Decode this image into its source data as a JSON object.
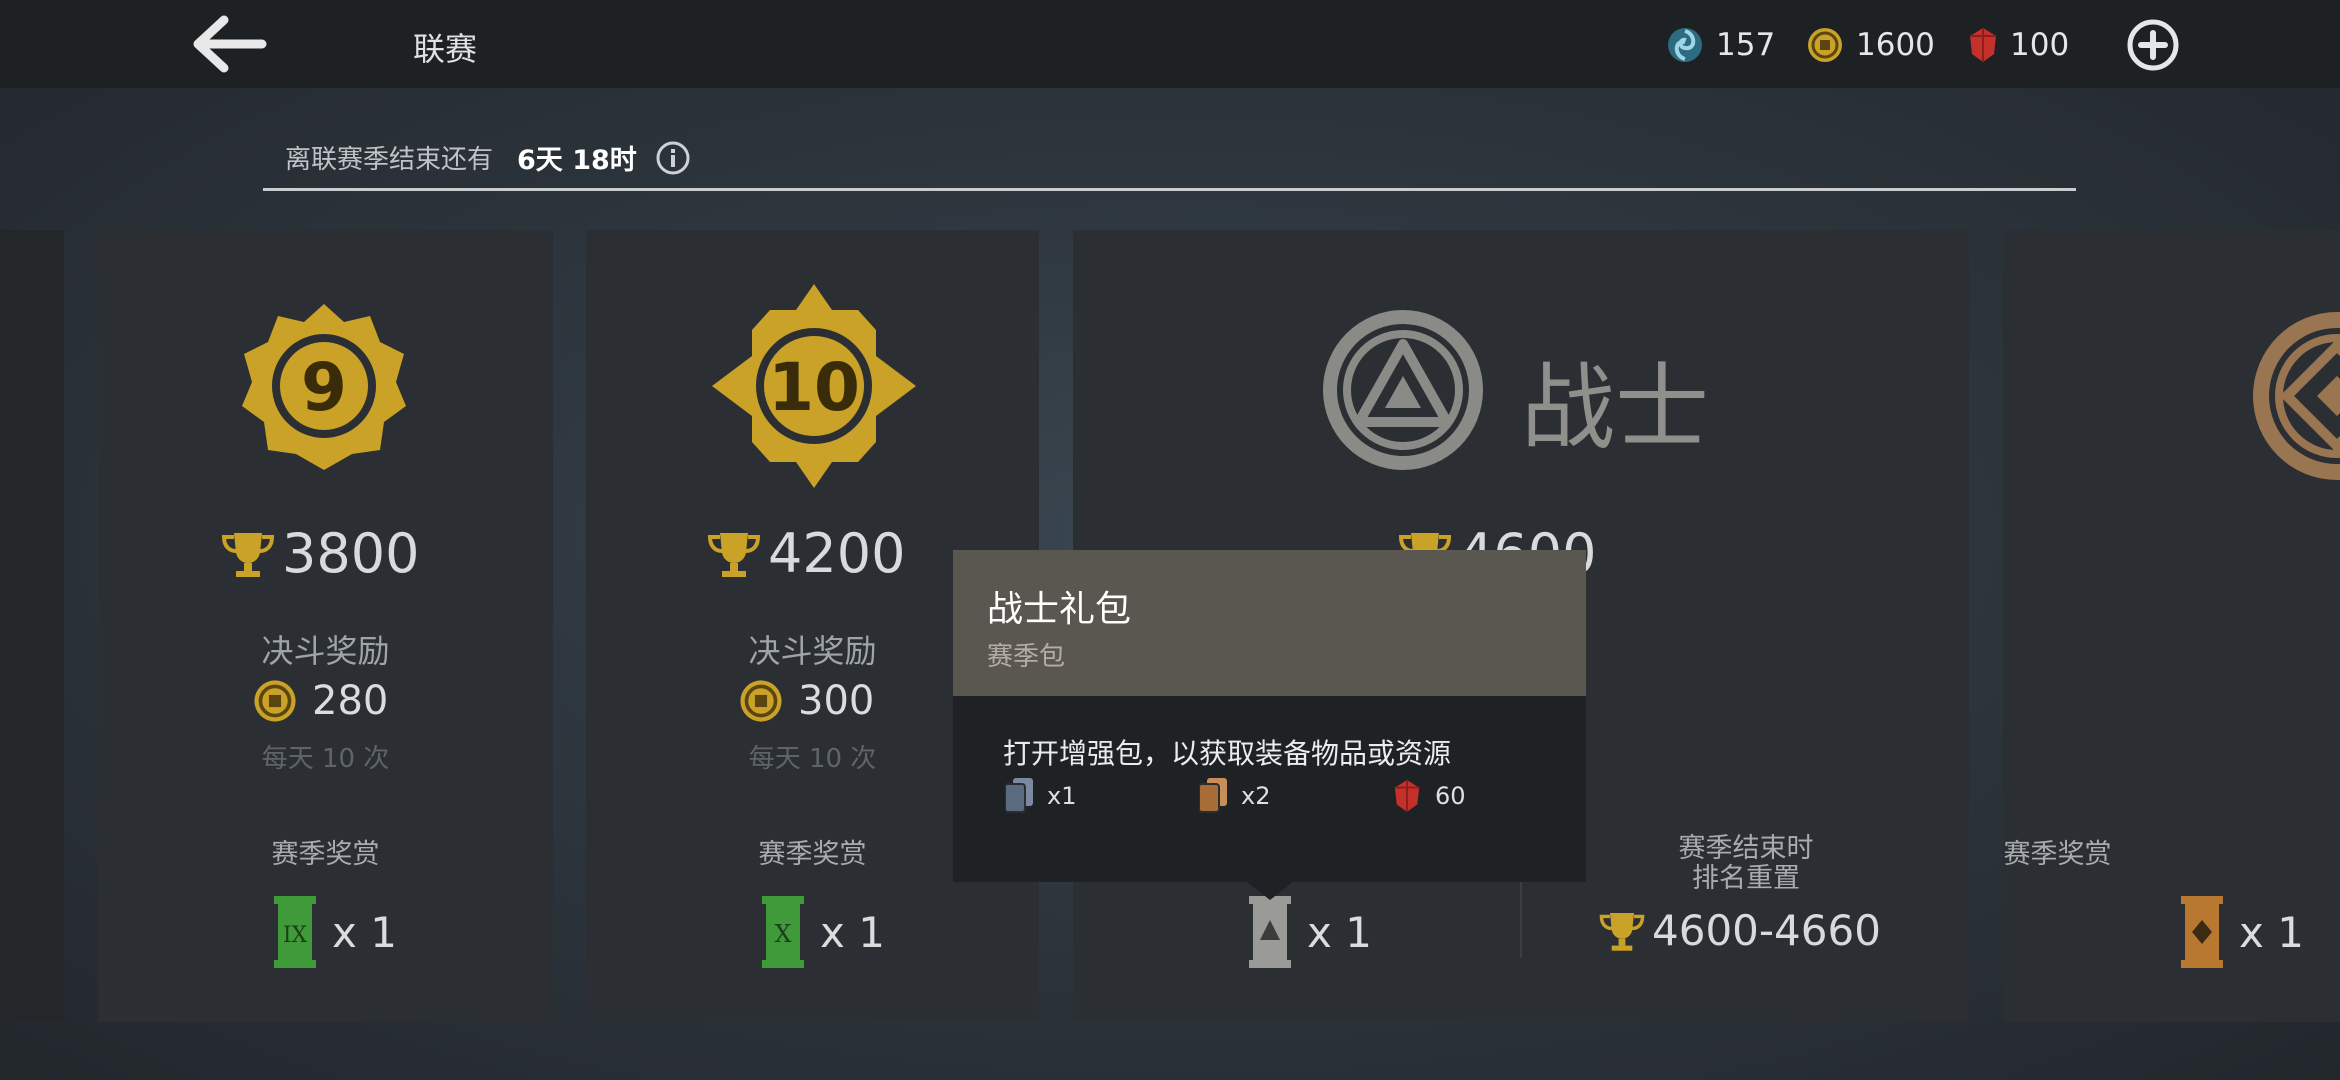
{
  "header": {
    "title": "联赛",
    "back_icon": "arrow-left-icon",
    "currencies": [
      {
        "icon": "spirit-orb-icon",
        "value": "157"
      },
      {
        "icon": "coin-icon",
        "value": "1600"
      },
      {
        "icon": "ruby-icon",
        "value": "100"
      }
    ],
    "plus_icon": "plus-circle-icon"
  },
  "timer": {
    "label": "离联赛季结束还有",
    "value": "6天 18时",
    "info_icon": "info-icon"
  },
  "ranks": [
    {
      "rank": "9",
      "trophies": "3800",
      "duel_label": "决斗奖励",
      "duel_coins": "280",
      "daily": "每天 10 次",
      "season_label": "赛季奖赏",
      "reward_roman": "IX",
      "reward_qty": "x 1"
    },
    {
      "rank": "10",
      "trophies": "4200",
      "duel_label": "决斗奖励",
      "duel_coins": "300",
      "daily": "每天 10 次",
      "season_label": "赛季奖赏",
      "reward_roman": "X",
      "reward_qty": "x 1"
    }
  ],
  "warrior": {
    "name": "战士",
    "trophies": "4600",
    "reward_qty": "x 1",
    "reset_label_1": "赛季结束时",
    "reset_label_2": "排名重置",
    "reset_range": "4600-4660"
  },
  "partial_card": {
    "season_label": "赛季奖赏",
    "reward_qty": "x 1"
  },
  "tooltip": {
    "title": "战士礼包",
    "subtitle": "赛季包",
    "description": "打开增强包，以获取装备物品或资源",
    "items": [
      {
        "icon": "blue-card-icon",
        "qty": "x1"
      },
      {
        "icon": "orange-card-icon",
        "qty": "x2"
      },
      {
        "icon": "ruby-icon",
        "qty": "60"
      }
    ]
  },
  "colors": {
    "gold": "#c9a227",
    "green": "#3f9a3a",
    "ruby": "#c4302b",
    "tooltip_header": "#5a5650"
  }
}
